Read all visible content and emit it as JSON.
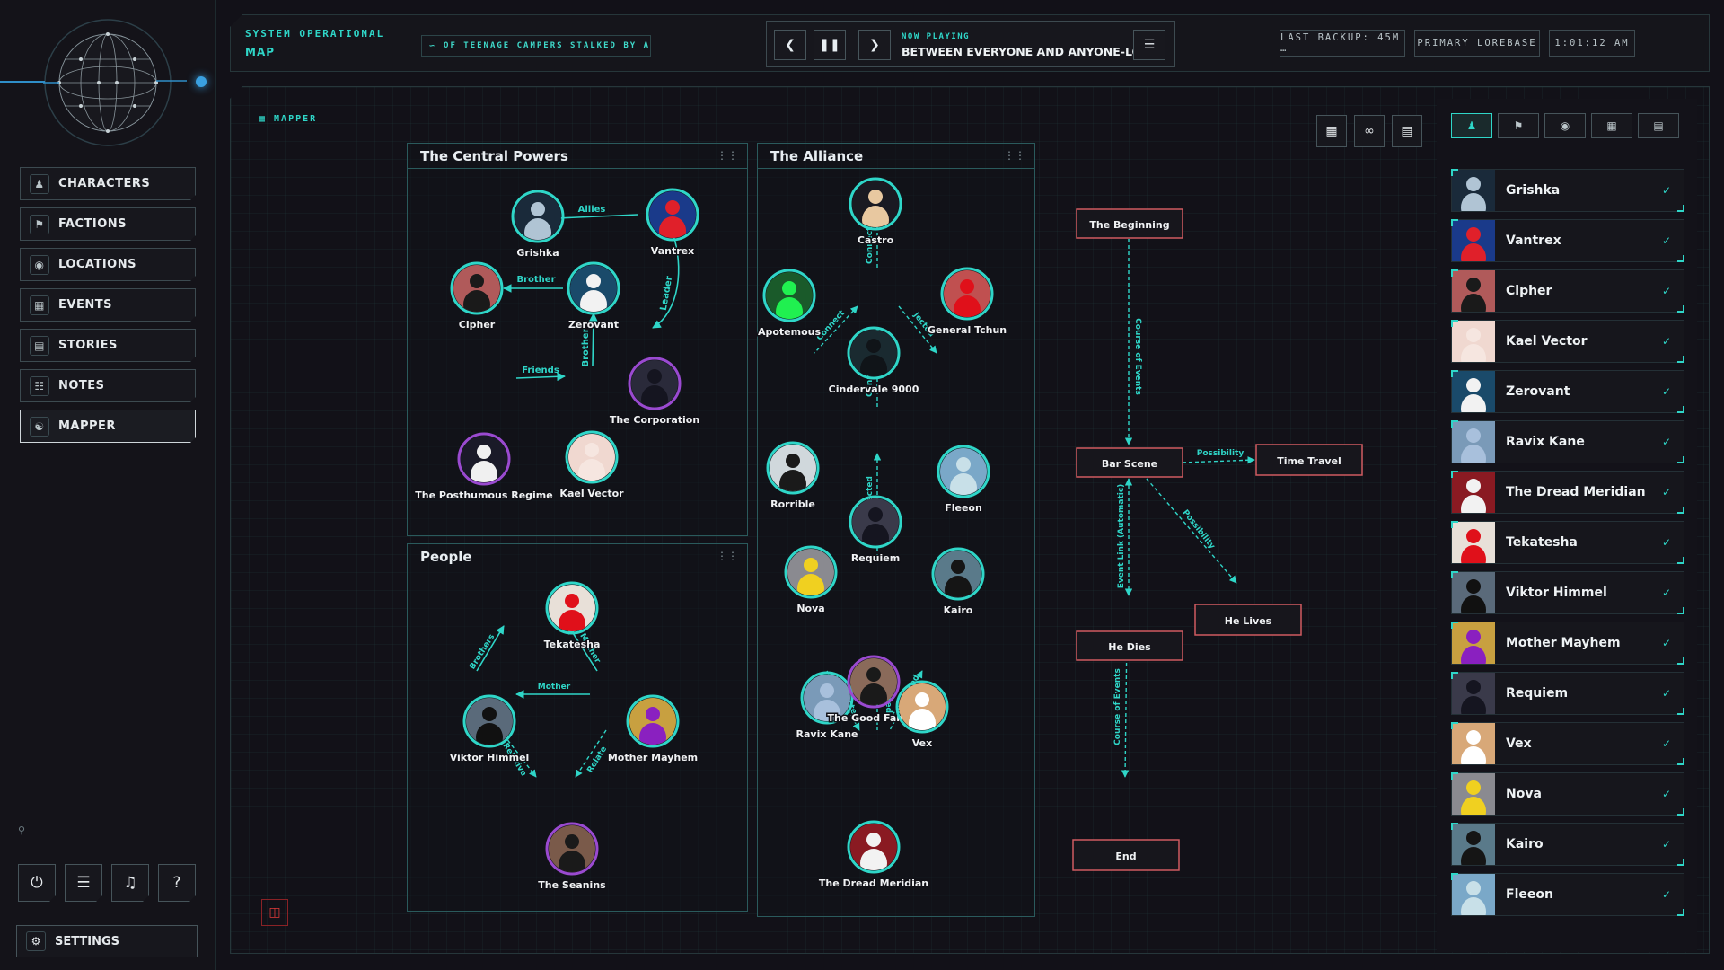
{
  "topbar": {
    "status_line1": "SYSTEM OPERATIONAL",
    "status_line2": "MAP",
    "ticker_text": "OF TEENAGE CAMPERS STALKED BY A",
    "now_playing_label": "NOW PLAYING",
    "now_playing_title": "BETWEEN EVERYONE AND ANYONE-LOOP",
    "last_backup": "LAST BACKUP: 45M …",
    "lorebase": "PRIMARY LOREBASE",
    "clock": "1:01:12 AM"
  },
  "sidebar": {
    "items": [
      {
        "label": "CHARACTERS",
        "icon": "users-icon",
        "active": false
      },
      {
        "label": "FACTIONS",
        "icon": "flag-icon",
        "active": false
      },
      {
        "label": "LOCATIONS",
        "icon": "map-pin-icon",
        "active": false
      },
      {
        "label": "EVENTS",
        "icon": "calendar-icon",
        "active": false
      },
      {
        "label": "STORIES",
        "icon": "book-icon",
        "active": false
      },
      {
        "label": "NOTES",
        "icon": "document-icon",
        "active": false
      },
      {
        "label": "MAPPER",
        "icon": "network-icon",
        "active": true
      }
    ],
    "settings_label": "SETTINGS",
    "tools": [
      "plug-icon",
      "database-icon",
      "music-icon",
      "help-icon"
    ]
  },
  "mapper": {
    "label": "MAPPER",
    "groups": {
      "central": "The Central Powers",
      "alliance": "The Alliance",
      "people": "People"
    },
    "nodes": {
      "grishka": "Grishka",
      "vantrex": "Vantrex",
      "cipher": "Cipher",
      "zerovant": "Zerovant",
      "corporation": "The Corporation",
      "posthumous": "The Posthumous Regime",
      "kael": "Kael Vector",
      "castro": "Castro",
      "apotemous": "Apotemous",
      "tchun": "General Tchun",
      "cindervale": "Cindervale 9000",
      "rorrible": "Rorrible",
      "fleeon": "Fleeon",
      "requiem": "Requiem",
      "nova": "Nova",
      "kairo": "Kairo",
      "ravix": "Ravix Kane",
      "goodfamily": "The Good Family",
      "vex": "Vex",
      "dread": "The Dread Meridian",
      "tekatesha": "Tekatesha",
      "viktor": "Viktor Himmel",
      "mayhem": "Mother Mayhem",
      "seanins": "The Seanins"
    },
    "edges": {
      "allies": "Allies",
      "brother": "Brother",
      "leader": "Leader",
      "brother2": "Brother",
      "friends": "Friends",
      "connected": "Connected",
      "connect": "Connect",
      "jected": "jected",
      "brothers": "Brothers",
      "mother": "Mother",
      "mother2": "Mother",
      "relative": "Relative",
      "relate": "Relate"
    },
    "events": {
      "beginning": "The Beginning",
      "bar": "Bar Scene",
      "time": "Time Travel",
      "lives": "He Lives",
      "dies": "He Dies",
      "end": "End"
    },
    "event_edges": {
      "course1": "Course of Events",
      "possibility1": "Possibility",
      "possibility2": "Possibility",
      "eventlink": "Event Link (Automatic)",
      "course2": "Course of Events"
    }
  },
  "right_panel": {
    "tabs": [
      "users-icon",
      "flag-icon",
      "map-pin-icon",
      "calendar-icon",
      "book-icon"
    ],
    "characters": [
      {
        "name": "Grishka",
        "color": "#1a2a3a",
        "fig": "#b0c4d4"
      },
      {
        "name": "Vantrex",
        "color": "#1a3a8a",
        "fig": "#e0202a"
      },
      {
        "name": "Cipher",
        "color": "#b05a5a",
        "fig": "#1a1a1a"
      },
      {
        "name": "Kael Vector",
        "color": "#f0d8d0",
        "fig": "#f6e6e0"
      },
      {
        "name": "Zerovant",
        "color": "#1a4a6a",
        "fig": "#f2f2f2"
      },
      {
        "name": "Ravix Kane",
        "color": "#7a9ab8",
        "fig": "#a8c0dc"
      },
      {
        "name": "The Dread Meridian",
        "color": "#8a1a22",
        "fig": "#f2f2f2"
      },
      {
        "name": "Tekatesha",
        "color": "#e8e0d8",
        "fig": "#e0101a"
      },
      {
        "name": "Viktor Himmel",
        "color": "#5a6a7a",
        "fig": "#111111"
      },
      {
        "name": "Mother Mayhem",
        "color": "#c8a040",
        "fig": "#8a20c0"
      },
      {
        "name": "Requiem",
        "color": "#3a3a4a",
        "fig": "#151520"
      },
      {
        "name": "Vex",
        "color": "#d8a878",
        "fig": "#ffffff"
      },
      {
        "name": "Nova",
        "color": "#8a8a90",
        "fig": "#f0d020"
      },
      {
        "name": "Kairo",
        "color": "#5a7a8a",
        "fig": "#151515"
      },
      {
        "name": "Fleeon",
        "color": "#7aa8c8",
        "fig": "#c8e0e8"
      }
    ]
  }
}
